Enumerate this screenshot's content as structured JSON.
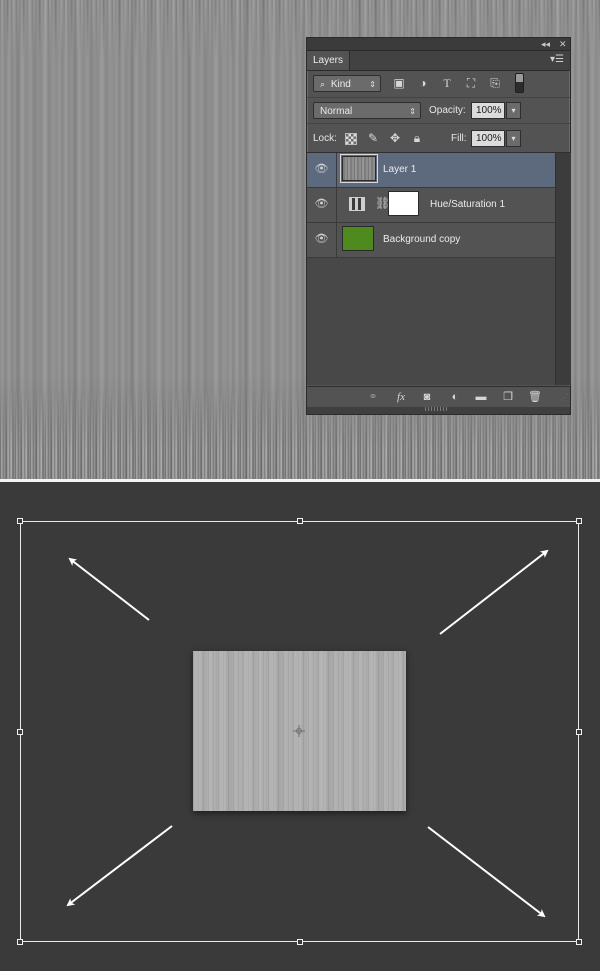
{
  "layers_panel": {
    "tab_label": "Layers",
    "filter": {
      "kind_value": "Kind",
      "filter_icons": [
        "image-filter-icon",
        "adjustment-filter-icon",
        "type-filter-icon",
        "shape-filter-icon",
        "smart-object-filter-icon"
      ]
    },
    "blend_mode": "Normal",
    "opacity_label": "Opacity:",
    "opacity_value": "100%",
    "lock_label": "Lock:",
    "lock_icons": [
      "lock-transparent-pixels-icon",
      "lock-image-pixels-icon",
      "lock-position-icon",
      "lock-all-icon"
    ],
    "fill_label": "Fill:",
    "fill_value": "100%",
    "layers": [
      {
        "name": "Layer 1",
        "selected": true,
        "visible": true,
        "thumbnail": "gray-texture"
      },
      {
        "name": "Hue/Saturation 1",
        "selected": false,
        "visible": true,
        "thumbnail": "adjustment-mask-white"
      },
      {
        "name": "Background copy",
        "selected": false,
        "visible": true,
        "thumbnail": "green-fill"
      }
    ],
    "footer_icons": [
      "link-layers-icon",
      "layer-style-fx-icon",
      "add-mask-icon",
      "new-adjustment-layer-icon",
      "new-group-icon",
      "new-layer-icon",
      "delete-layer-icon"
    ],
    "fx_label": "fx",
    "colors": {
      "panel_bg": "#535353",
      "selected_row": "#5d6a7e",
      "background_copy_thumb": "#4f8a1f"
    }
  },
  "transform": {
    "arrows": [
      "arrow-up-left",
      "arrow-up-right",
      "arrow-down-left",
      "arrow-down-right"
    ],
    "colors": {
      "workspace_bg": "#3a3a3a",
      "bounding_box": "#e9e9e9",
      "texture": "#adadad"
    }
  }
}
